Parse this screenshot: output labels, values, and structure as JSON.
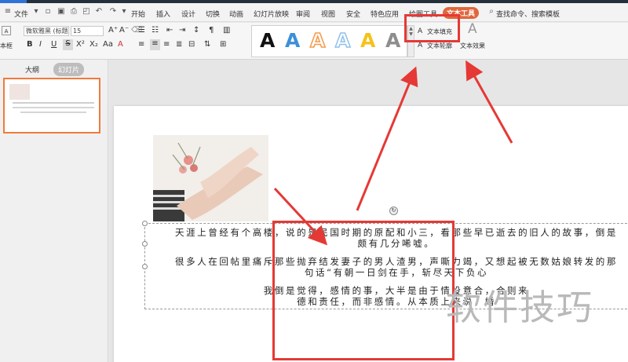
{
  "menubar": {
    "file_label": "文件",
    "tabs": [
      "开始",
      "插入",
      "设计",
      "切换",
      "动画",
      "幻灯片放映",
      "审阅",
      "视图",
      "安全",
      "特色应用",
      "绘图工具",
      "文本工具"
    ],
    "search_label": "查找命令、搜索模板"
  },
  "ribbon": {
    "font_name": "微软雅黑 (标题",
    "font_size": "15",
    "textbox_label": "本框",
    "text_fill_label": "文本填充",
    "text_outline_label": "文本轮廓",
    "text_effect_label": "文本效果",
    "gallery": [
      {
        "letter": "A",
        "color": "#111111",
        "style": "solid"
      },
      {
        "letter": "A",
        "color": "#3d8fd8",
        "style": "solid"
      },
      {
        "letter": "A",
        "color": "#f39a4a",
        "style": "outline"
      },
      {
        "letter": "A",
        "color": "#8fc1ec",
        "style": "outline"
      },
      {
        "letter": "A",
        "color": "#f4c21b",
        "style": "solid"
      },
      {
        "letter": "A",
        "color": "#8d8d8d",
        "style": "solid"
      }
    ]
  },
  "left_panel": {
    "tab_outline": "大纲",
    "tab_slides": "幻灯片",
    "slide_number": "1"
  },
  "slide": {
    "paragraphs": [
      {
        "line1": "天涯上曾经有个高楼，说的是民国时期的原配和小三，看那些早已逝去的旧人的故事，倒是",
        "line2": "颇有几分唏嘘。"
      },
      {
        "line1": "很多人在回帖里痛斥那些抛弃结发妻子的男人渣男，声嘶力竭，又想起被无数姑娘转发的那",
        "line2": "句话“有朝一日剑在手，斩尽天下负心"
      },
      {
        "line1": "我倒是觉得，感情的事，大半是由于情投意合，合则来",
        "line2": "德和责任，而非感情。从本质上来说，婚"
      }
    ]
  },
  "watermark": "软件技巧",
  "colors": {
    "accent_red": "#e53935",
    "tab_orange": "#e0663c"
  }
}
